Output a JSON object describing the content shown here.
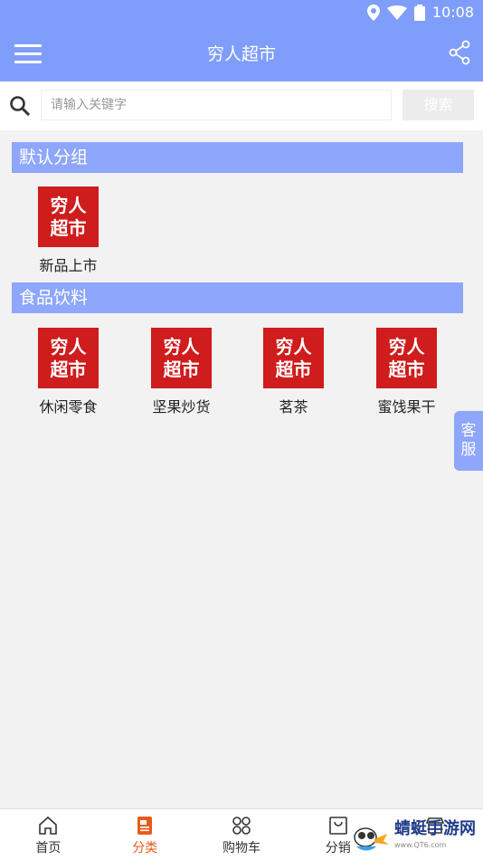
{
  "status": {
    "time": "10:08"
  },
  "appbar": {
    "title": "穷人超市"
  },
  "search": {
    "placeholder": "请输入关键字",
    "button": "搜索"
  },
  "sections": [
    {
      "title": "默认分组",
      "items": [
        {
          "logo_line1": "穷人",
          "logo_line2": "超市",
          "label": "新品上市"
        }
      ]
    },
    {
      "title": "食品饮料",
      "items": [
        {
          "logo_line1": "穷人",
          "logo_line2": "超市",
          "label": "休闲零食"
        },
        {
          "logo_line1": "穷人",
          "logo_line2": "超市",
          "label": "坚果炒货"
        },
        {
          "logo_line1": "穷人",
          "logo_line2": "超市",
          "label": "茗茶"
        },
        {
          "logo_line1": "穷人",
          "logo_line2": "超市",
          "label": "蜜饯果干"
        }
      ]
    }
  ],
  "kefu": {
    "line1": "客",
    "line2": "服"
  },
  "nav": [
    {
      "label": "首页",
      "icon": "home-icon"
    },
    {
      "label": "分类",
      "icon": "category-icon",
      "active": true
    },
    {
      "label": "购物车",
      "icon": "cart-icon"
    },
    {
      "label": "分销",
      "icon": "bag-icon"
    },
    {
      "label": "",
      "icon": "store-icon"
    }
  ],
  "watermark": {
    "text": "蜻蜓手游网",
    "sub": "www.QT6.com"
  },
  "colors": {
    "primary": "#7f9dfb",
    "section": "#8ea6fb",
    "logo": "#cf1c1c",
    "active": "#e85a1a"
  }
}
